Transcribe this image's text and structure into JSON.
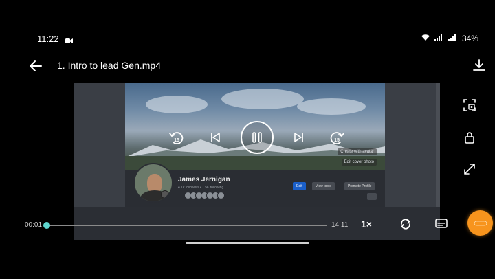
{
  "status_bar": {
    "time": "11:22",
    "battery": "34%",
    "icons": [
      "screen-record-icon",
      "wifi-icon",
      "signal-icon",
      "signal-icon"
    ]
  },
  "header": {
    "title": "1. Intro to lead Gen.mp4",
    "back_icon": "arrow-left-icon",
    "download_icon": "download-icon"
  },
  "video_frame": {
    "profile_name": "James Jernigan",
    "profile_sub": "4.1k followers • 1.5K following",
    "cover_buttons": [
      "Create with avatar",
      "Edit cover photo"
    ],
    "profile_buttons": [
      "Edit",
      "View tools",
      "Promote Profile"
    ]
  },
  "controls": {
    "rewind_label": "15",
    "forward_label": "15",
    "state": "playing"
  },
  "side_controls": [
    "screenshot-icon",
    "lock-icon",
    "fullscreen-icon"
  ],
  "playback": {
    "current_time": "00:01",
    "total_time": "14:11",
    "progress": 0.0012,
    "speed": "1×"
  },
  "colors": {
    "accent": "#45c9c2",
    "fab": "#f7941d",
    "fb_blue": "#1a5fc9"
  }
}
